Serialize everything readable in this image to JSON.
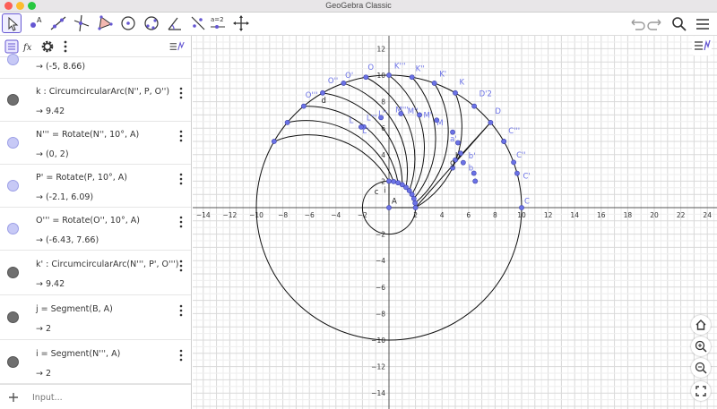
{
  "window": {
    "title": "GeoGebra Classic",
    "dots": [
      "#fc5f57",
      "#fdbc2e",
      "#28c840"
    ]
  },
  "toolbar": {
    "tools": [
      {
        "name": "move-tool",
        "icon": "arrow-cursor-icon"
      },
      {
        "name": "point-tool",
        "icon": "point-a-icon"
      },
      {
        "name": "line-tool",
        "icon": "line-icon"
      },
      {
        "name": "perpendicular-line-tool",
        "icon": "perpendicular-icon"
      },
      {
        "name": "polygon-tool",
        "icon": "polygon-icon"
      },
      {
        "name": "circle-tool",
        "icon": "circle-icon"
      },
      {
        "name": "conic-tool",
        "icon": "conic-icon"
      },
      {
        "name": "angle-tool",
        "icon": "angle-icon"
      },
      {
        "name": "reflect-tool",
        "icon": "reflect-icon"
      },
      {
        "name": "slider-tool",
        "icon": "slider-icon",
        "label": "a=2"
      },
      {
        "name": "move-graphics-tool",
        "icon": "move-cross-icon"
      }
    ],
    "accent": "#6557d2"
  },
  "algebra": {
    "partial_value": "→ (-5, 8.66)",
    "items": [
      {
        "def": "k : CircumcircularArc(N'', P, O'')",
        "value": "→ 9.42",
        "marker": "dark"
      },
      {
        "def": "N''' = Rotate(N'', 10°, A)",
        "value": "→ (0, 2)",
        "marker": "blue"
      },
      {
        "def": "P' = Rotate(P, 10°, A)",
        "value": "→ (-2.1, 6.09)",
        "marker": "blue"
      },
      {
        "def": "O''' = Rotate(O'', 10°, A)",
        "value": "→ (-6.43, 7.66)",
        "marker": "blue"
      },
      {
        "def": "k' : CircumcircularArc(N''', P', O''')",
        "value": "→ 9.42",
        "marker": "dark"
      },
      {
        "def": "j = Segment(B, A)",
        "value": "→ 2",
        "marker": "dark"
      },
      {
        "def": "i = Segment(N''', A)",
        "value": "→ 2",
        "marker": "dark"
      }
    ],
    "input_placeholder": "Input..."
  },
  "graph": {
    "x_ticks": [
      "−14",
      "−12",
      "−10",
      "−8",
      "−6",
      "−4",
      "−2",
      "2",
      "4",
      "6",
      "8",
      "10",
      "12",
      "14",
      "16",
      "18",
      "20",
      "22",
      "24"
    ],
    "y_ticks": [
      "12",
      "10",
      "8",
      "6",
      "4",
      "2",
      "−2",
      "−4",
      "−6",
      "−8",
      "−10",
      "−12",
      "−14"
    ],
    "origin_label": "A",
    "point_labels": [
      "O'''",
      "O''",
      "O'",
      "O",
      "K'''",
      "K''",
      "K'",
      "K",
      "D'2",
      "D",
      "C'''",
      "C''",
      "C'",
      "C",
      "d",
      "c",
      "i",
      "M'''",
      "M''",
      "M'",
      "M",
      "a'",
      "b'",
      "b",
      "L'''",
      "L''",
      "L'",
      "L",
      "h",
      "g"
    ],
    "point_color": "#6b72e6"
  }
}
